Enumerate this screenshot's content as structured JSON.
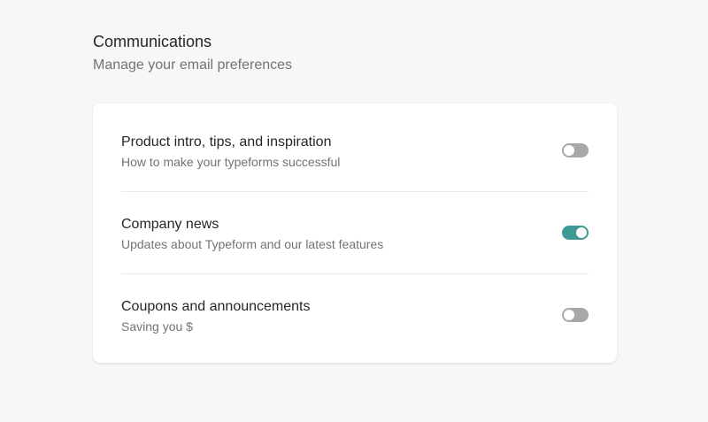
{
  "header": {
    "title": "Communications",
    "subtitle": "Manage your email preferences"
  },
  "preferences": [
    {
      "label": "Product intro, tips, and inspiration",
      "description": "How to make your typeforms successful",
      "enabled": false
    },
    {
      "label": "Company news",
      "description": "Updates about Typeform and our latest features",
      "enabled": true
    },
    {
      "label": "Coupons and announcements",
      "description": "Saving you $",
      "enabled": false
    }
  ],
  "colors": {
    "toggle_on": "#3d9a94",
    "toggle_off": "#a8a8a8"
  }
}
